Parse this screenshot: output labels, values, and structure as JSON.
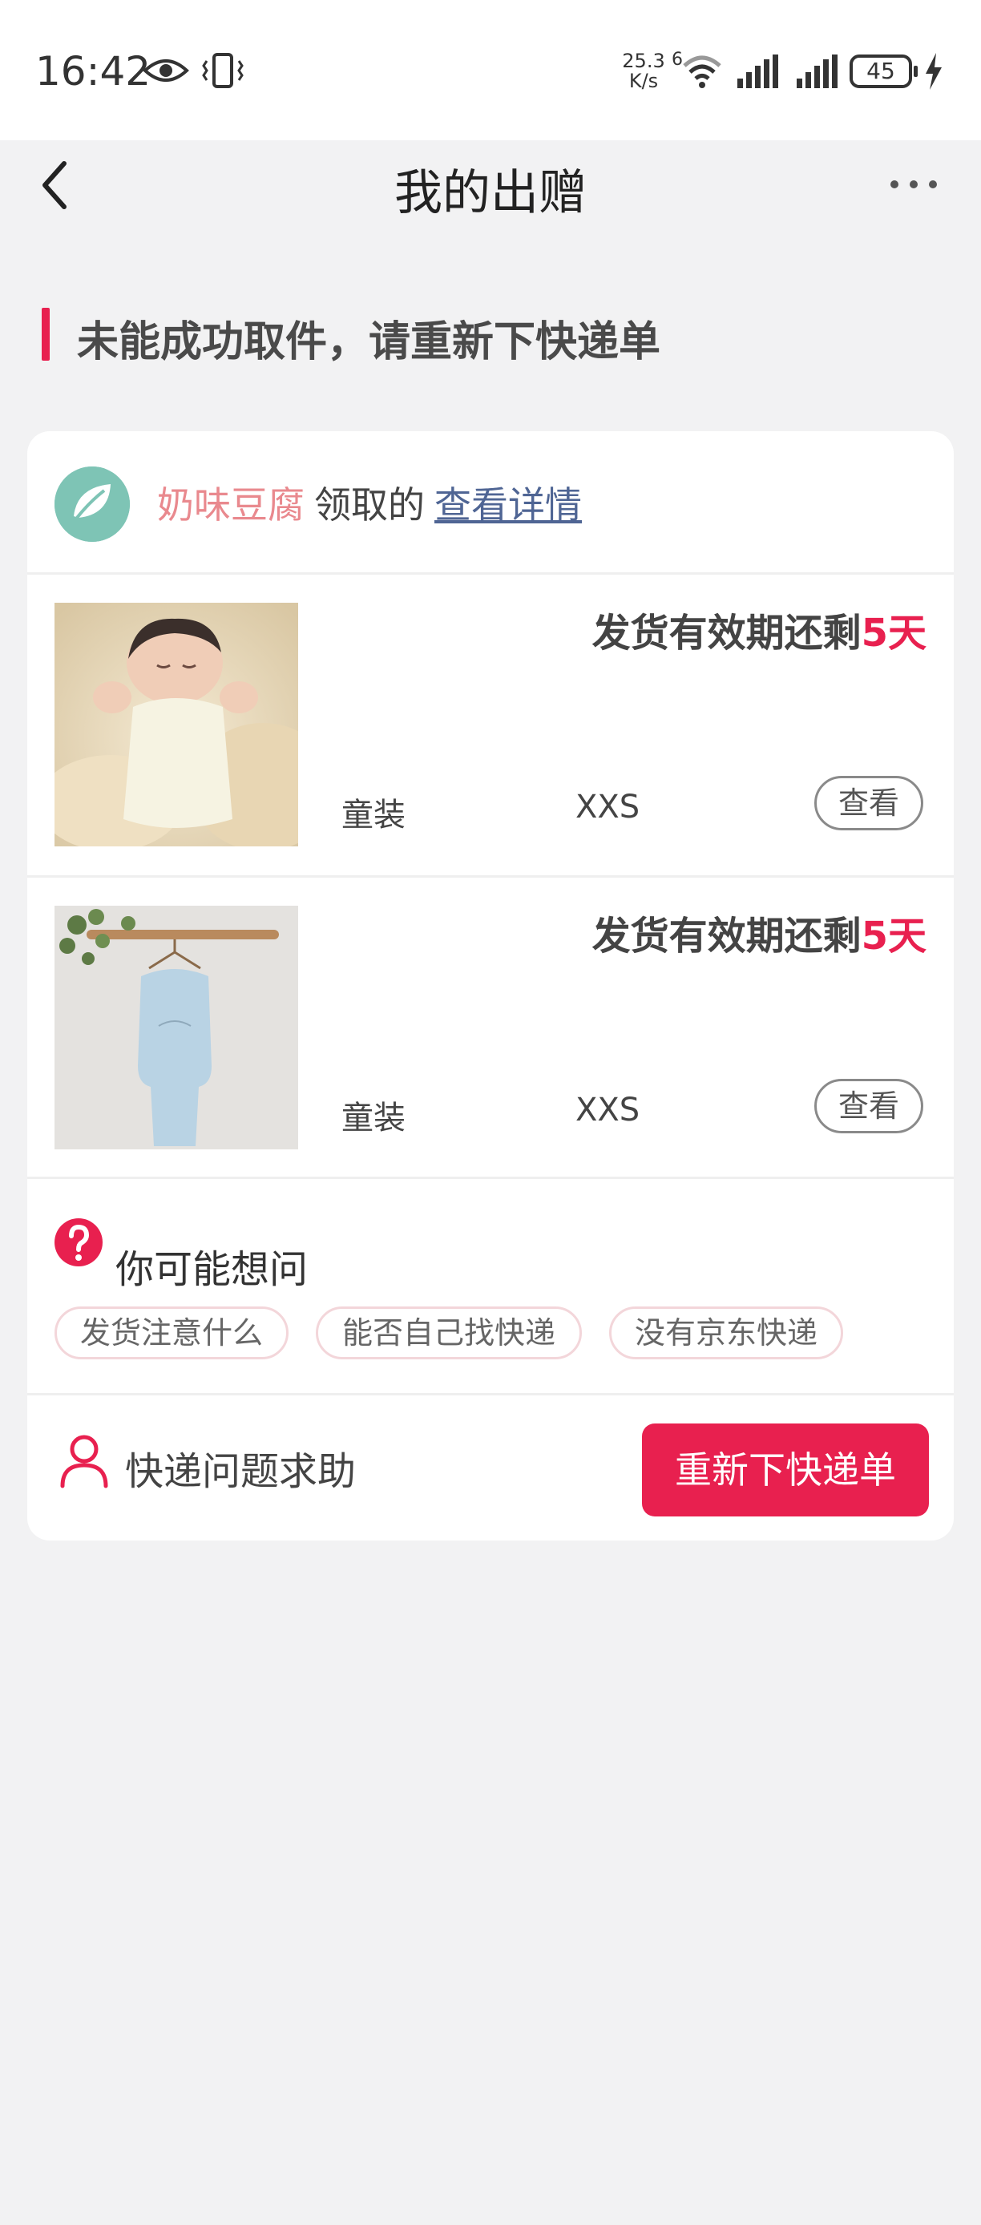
{
  "status_bar": {
    "time": "16:42",
    "net_speed_value": "25.3",
    "net_speed_unit": "K/s",
    "network_type": "6",
    "battery": "45",
    "icons": [
      "eye-icon",
      "vibrate-icon",
      "wifi-icon",
      "signal-icon",
      "signal-icon",
      "battery-icon",
      "charging-icon"
    ]
  },
  "nav": {
    "title": "我的出赠",
    "back_icon": "chevron-left-icon",
    "more_icon": "more-dots-icon"
  },
  "notice": {
    "text": "未能成功取件，请重新下快递单",
    "accent": "#e8204f"
  },
  "receiver": {
    "name": "奶味豆腐",
    "action": "领取的",
    "link": "查看详情"
  },
  "items": [
    {
      "deadline_prefix": "发货有效期还剩",
      "deadline_days": "5天",
      "category": "童装",
      "size": "XXS",
      "view_label": "查看"
    },
    {
      "deadline_prefix": "发货有效期还剩",
      "deadline_days": "5天",
      "category": "童装",
      "size": "XXS",
      "view_label": "查看"
    }
  ],
  "faq": {
    "title": "你可能想问",
    "chips": [
      "发货注意什么",
      "能否自己找快递",
      "没有京东快递"
    ]
  },
  "help": {
    "label": "快递问题求助",
    "button": "重新下快递单"
  },
  "colors": {
    "primary": "#e8204f",
    "page_bg": "#f2f2f3",
    "link": "#4f6594"
  }
}
